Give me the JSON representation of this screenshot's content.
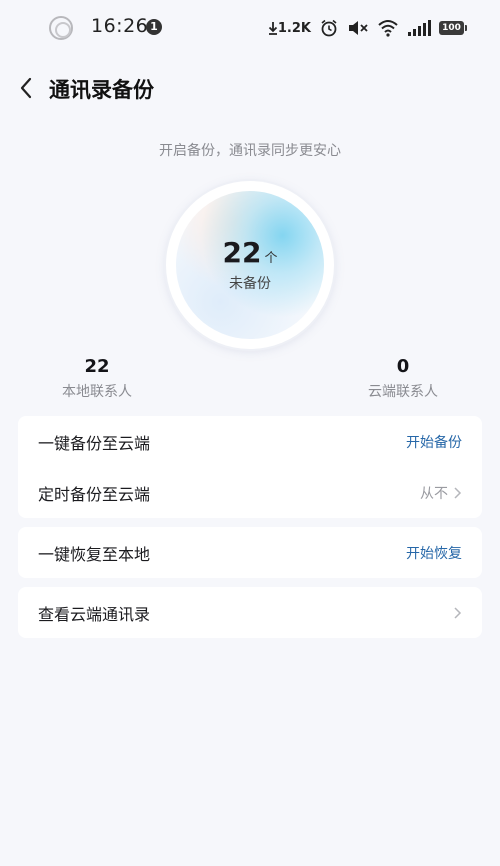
{
  "status_bar": {
    "time": "16:26",
    "notification_count": "1",
    "net_speed": "1.2K",
    "battery": "100",
    "icons": [
      "download-arrow-icon",
      "alarm-icon",
      "mute-icon",
      "wifi-icon",
      "signal-icon",
      "battery-icon"
    ]
  },
  "header": {
    "title": "通讯录备份"
  },
  "subtitle": "开启备份，通讯录同步更安心",
  "backup": {
    "count": "22",
    "unit": "个",
    "caption": "未备份"
  },
  "stats": {
    "local": {
      "value": "22",
      "label": "本地联系人"
    },
    "cloud": {
      "value": "0",
      "label": "云端联系人"
    }
  },
  "cards": {
    "backup": {
      "one_click_label": "一键备份至云端",
      "one_click_action": "开始备份",
      "scheduled_label": "定时备份至云端",
      "scheduled_value": "从不"
    },
    "restore": {
      "label": "一键恢复至本地",
      "action": "开始恢复"
    },
    "view": {
      "label": "查看云端通讯录"
    }
  },
  "colors": {
    "accent": "#2667a8",
    "background": "#f6f7fb",
    "card": "#ffffff",
    "muted_text": "#8a8b91"
  }
}
